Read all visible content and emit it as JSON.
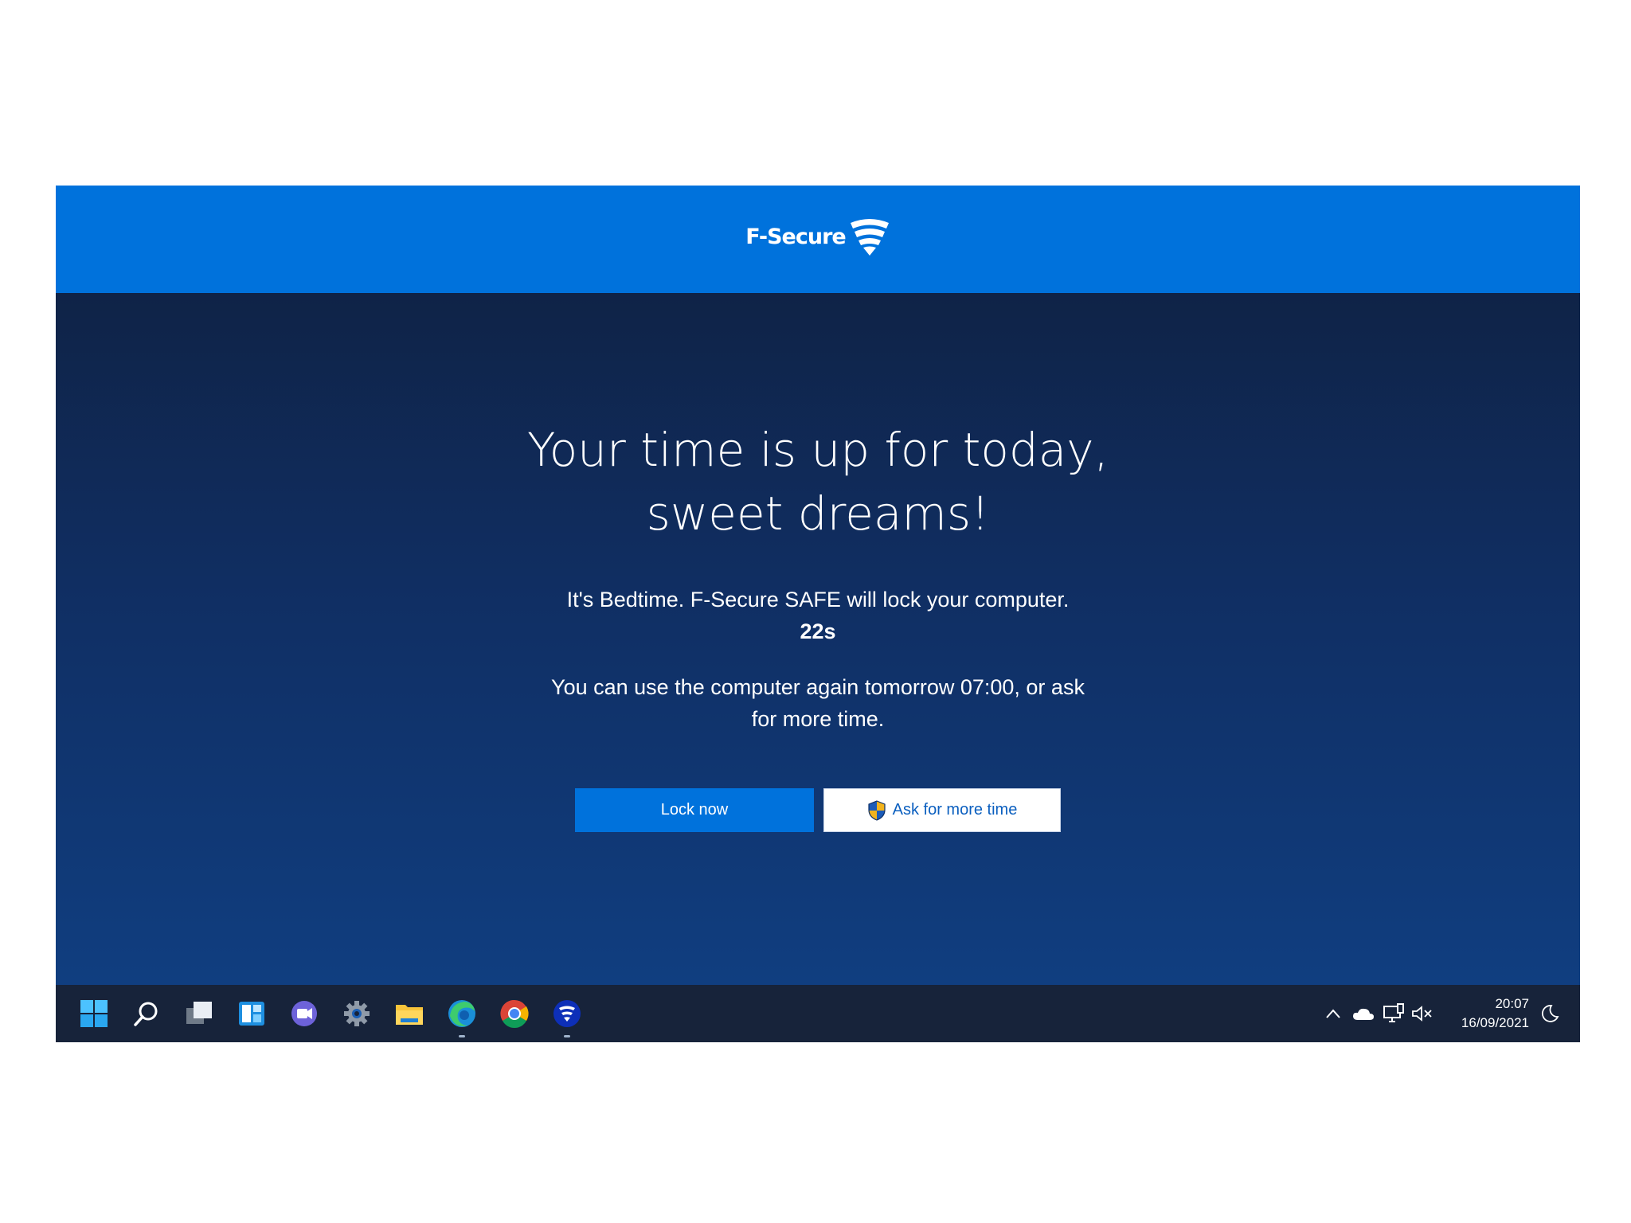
{
  "brand": {
    "name": "F-Secure",
    "bar_color": "#0072dc"
  },
  "message": {
    "headline_line1": "Your time is up for today,",
    "headline_line2": "sweet dreams!",
    "info": "It's Bedtime. F-Secure SAFE will lock your computer.",
    "countdown": "22s",
    "again_line1": "You can use the computer again tomorrow 07:00, or ask",
    "again_line2": "for more time."
  },
  "buttons": {
    "lock_label": "Lock now",
    "ask_label": "Ask for more time",
    "ask_icon": "uac-shield-icon"
  },
  "taskbar": {
    "pinned": [
      {
        "name": "start-icon"
      },
      {
        "name": "search-icon"
      },
      {
        "name": "task-view-icon"
      },
      {
        "name": "widgets-icon"
      },
      {
        "name": "teams-chat-icon"
      },
      {
        "name": "settings-icon"
      },
      {
        "name": "file-explorer-icon"
      },
      {
        "name": "edge-icon",
        "running": true
      },
      {
        "name": "chrome-icon"
      },
      {
        "name": "f-secure-icon",
        "running": true
      }
    ],
    "tray": [
      {
        "name": "chevron-up-icon"
      },
      {
        "name": "onedrive-cloud-icon"
      },
      {
        "name": "network-icon"
      },
      {
        "name": "volume-muted-icon"
      }
    ],
    "clock": {
      "time": "20:07",
      "date": "16/09/2021"
    },
    "notifications_icon": "focus-moon-icon"
  }
}
